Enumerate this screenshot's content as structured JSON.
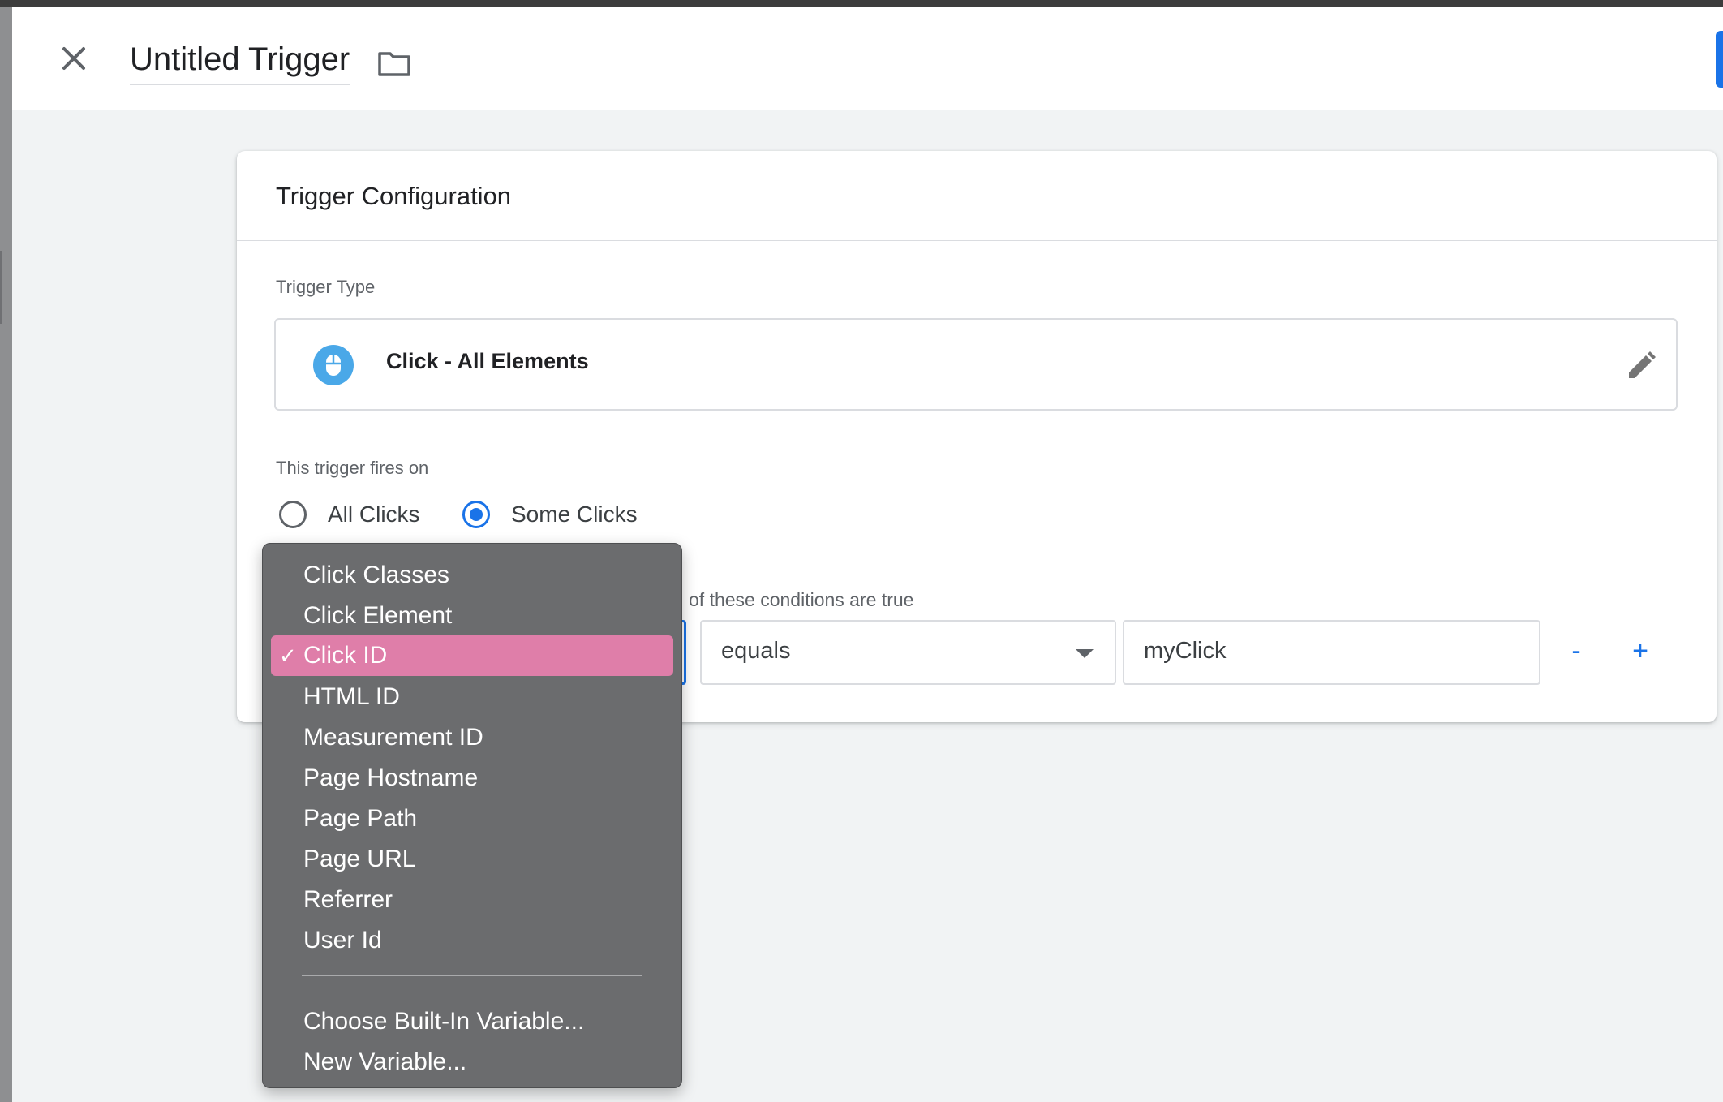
{
  "header": {
    "title": "Untitled Trigger",
    "close_icon": "close-icon",
    "folder_icon": "folder-icon",
    "accent_color": "#1a73e8"
  },
  "card": {
    "title": "Trigger Configuration",
    "trigger_type_label": "Trigger Type",
    "trigger_type_name": "Click - All Elements",
    "trigger_type_icon": "mouse-icon",
    "edit_icon": "pencil-icon",
    "fires_on_label": "This trigger fires on",
    "fires_on_options": [
      {
        "label": "All Clicks",
        "selected": false
      },
      {
        "label": "Some Clicks",
        "selected": true
      }
    ],
    "conditions_label": "of these conditions are true",
    "condition": {
      "variable": "Click ID",
      "operator": "equals",
      "value": "myClick"
    },
    "remove_label": "-",
    "add_label": "+"
  },
  "dropdown": {
    "items": [
      {
        "label": "Click Classes",
        "selected": false
      },
      {
        "label": "Click Element",
        "selected": false
      },
      {
        "label": "Click ID",
        "selected": true
      },
      {
        "label": "HTML ID",
        "selected": false
      },
      {
        "label": "Measurement ID",
        "selected": false
      },
      {
        "label": "Page Hostname",
        "selected": false
      },
      {
        "label": "Page Path",
        "selected": false
      },
      {
        "label": "Page URL",
        "selected": false
      },
      {
        "label": "Referrer",
        "selected": false
      },
      {
        "label": "User Id",
        "selected": false
      }
    ],
    "actions": [
      {
        "label": "Choose Built-In Variable..."
      },
      {
        "label": "New Variable..."
      }
    ],
    "check_mark": "✓",
    "highlight_color": "#df7ea9"
  }
}
